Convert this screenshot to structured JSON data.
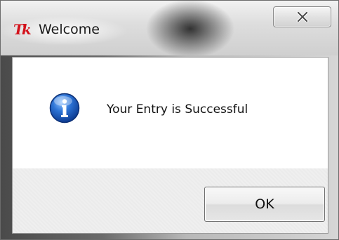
{
  "window": {
    "title": "Welcome",
    "app_icon": "tk-feather-icon",
    "close_icon": "close-icon"
  },
  "dialog": {
    "icon": "info-icon",
    "message": "Your Entry is Successful",
    "ok_label": "OK"
  },
  "colors": {
    "icon_red": "#d3121b",
    "info_blue": "#1f5fbf"
  }
}
